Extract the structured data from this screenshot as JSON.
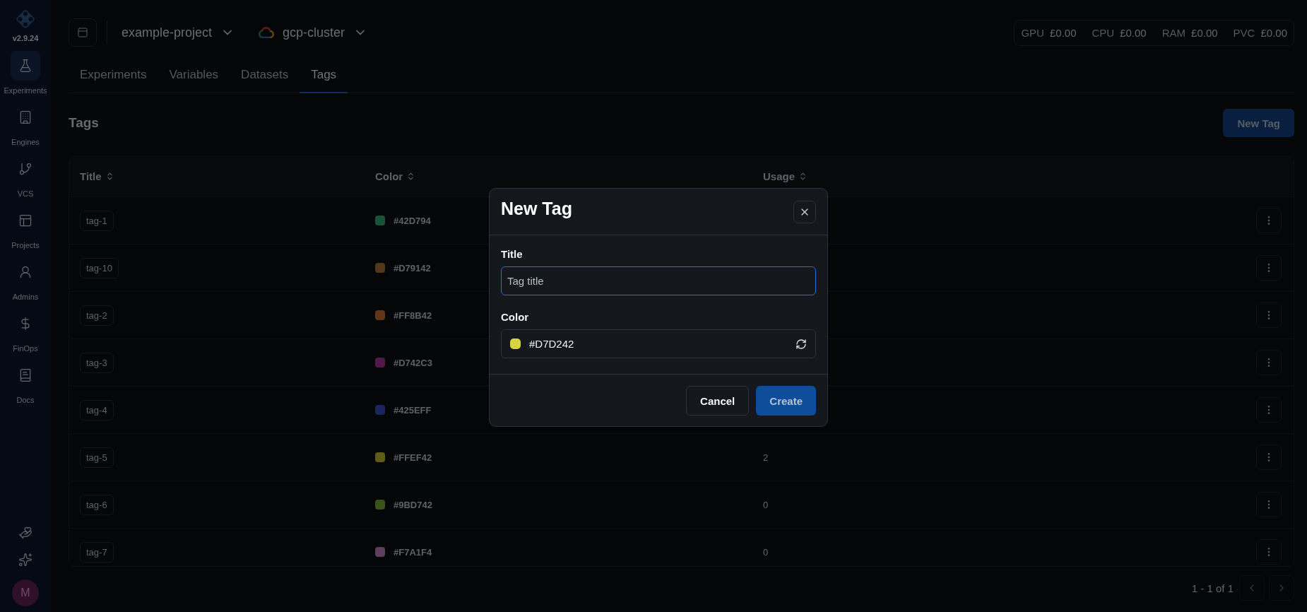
{
  "sidebar": {
    "version": "v2.9.24",
    "items": [
      {
        "label": "Experiments",
        "selected": true
      },
      {
        "label": "Engines",
        "selected": false
      },
      {
        "label": "VCS",
        "selected": false
      },
      {
        "label": "Projects",
        "selected": false
      },
      {
        "label": "Admins",
        "selected": false
      },
      {
        "label": "FinOps",
        "selected": false
      },
      {
        "label": "Docs",
        "selected": false
      }
    ],
    "avatar": "M"
  },
  "top_bar": {
    "project": "example-project",
    "cluster": "gcp-cluster",
    "costs": [
      {
        "label": "GPU",
        "value": "£0.00"
      },
      {
        "label": "CPU",
        "value": "£0.00"
      },
      {
        "label": "RAM",
        "value": "£0.00"
      },
      {
        "label": "PVC",
        "value": "£0.00"
      }
    ]
  },
  "tabs": [
    {
      "label": "Experiments",
      "selected": false
    },
    {
      "label": "Variables",
      "selected": false
    },
    {
      "label": "Datasets",
      "selected": false
    },
    {
      "label": "Tags",
      "selected": true
    }
  ],
  "page": {
    "title": "Tags",
    "new_button": "New Tag"
  },
  "table": {
    "columns": [
      "Title",
      "Color",
      "Usage"
    ],
    "rows": [
      {
        "title": "tag-1",
        "color": "#195238",
        "color_text": "#42D794"
      },
      {
        "title": "tag-10",
        "color": "#523719",
        "color_text": "#D79142"
      },
      {
        "title": "tag-2",
        "color": "#613519",
        "color_text": "#FF8B42"
      },
      {
        "title": "tag-3",
        "color": "#52194a",
        "color_text": "#D742C3"
      },
      {
        "title": "tag-4",
        "color": "#192461",
        "color_text": "#425EFF"
      },
      {
        "title": "tag-5",
        "color": "#615b19",
        "color_text": "#FFEF42",
        "usage": "2"
      },
      {
        "title": "tag-6",
        "color": "#3b5219",
        "color_text": "#9BD742",
        "usage": "0"
      },
      {
        "title": "tag-7",
        "color": "#5e3d5d",
        "color_text": "#F7A1F4",
        "usage": "0"
      }
    ]
  },
  "pagination": {
    "label": "1 - 1 of 1"
  },
  "dialog": {
    "title": "New Tag",
    "title_label": "Title",
    "title_placeholder": "Tag title",
    "title_focused": true,
    "color_label": "Color",
    "color": "#d7d242",
    "color_text": "#D7D242",
    "cancel": "Cancel",
    "create": "Create"
  }
}
